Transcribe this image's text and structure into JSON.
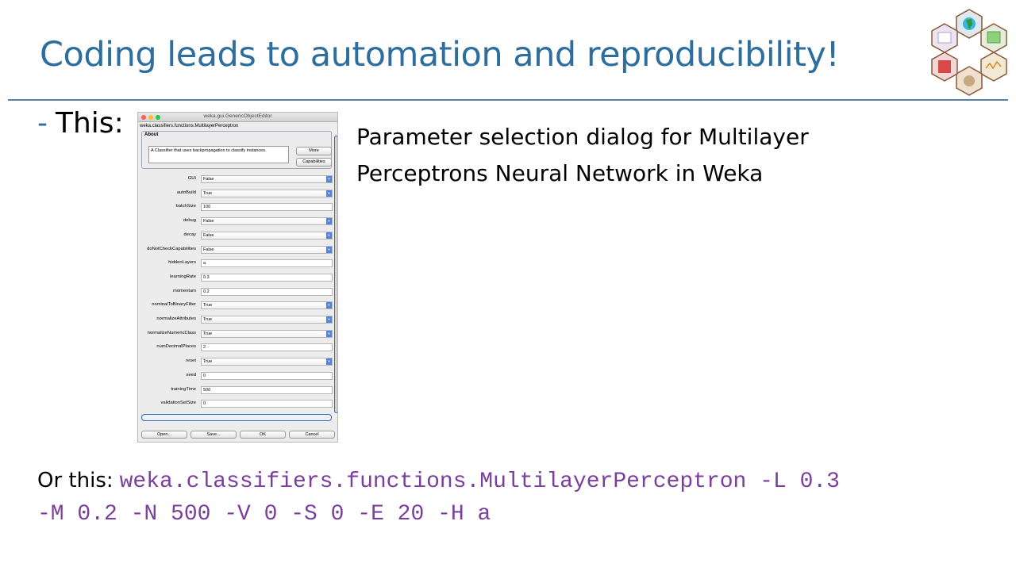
{
  "slide": {
    "title": "Coding leads to automation and reproducibility!",
    "bullet_dash": "-",
    "bullet_label": "This:",
    "description_line1": "Parameter selection dialog for Multilayer",
    "description_line2": "Perceptrons Neural Network in Weka",
    "cmd_prefix": "Or this:",
    "cmd_line1": "weka.classifiers.functions.MultilayerPerceptron -L 0.3",
    "cmd_line2": "-M 0.2 -N 500 -V 0 -S 0 -E 20 -H a"
  },
  "dialog": {
    "window_title": "weka.gui.GenericObjectEditor",
    "class_name": "weka.classifiers.functions.MultilayerPerceptron",
    "about_label": "About",
    "about_text": "A Classifier that uses backpropagation to classify instances.",
    "more_label": "More",
    "capabilities_label": "Capabilities",
    "params": [
      {
        "label": "GUI",
        "value": "False",
        "kind": "combo"
      },
      {
        "label": "autoBuild",
        "value": "True",
        "kind": "combo"
      },
      {
        "label": "batchSize",
        "value": "100",
        "kind": "text"
      },
      {
        "label": "debug",
        "value": "False",
        "kind": "combo"
      },
      {
        "label": "decay",
        "value": "False",
        "kind": "combo"
      },
      {
        "label": "doNotCheckCapabilities",
        "value": "False",
        "kind": "combo"
      },
      {
        "label": "hiddenLayers",
        "value": "a",
        "kind": "text"
      },
      {
        "label": "learningRate",
        "value": "0.3",
        "kind": "text"
      },
      {
        "label": "momentum",
        "value": "0.2",
        "kind": "text"
      },
      {
        "label": "nominalToBinaryFilter",
        "value": "True",
        "kind": "combo"
      },
      {
        "label": "normalizeAttributes",
        "value": "True",
        "kind": "combo"
      },
      {
        "label": "normalizeNumericClass",
        "value": "True",
        "kind": "combo"
      },
      {
        "label": "numDecimalPlaces",
        "value": "2",
        "kind": "text"
      },
      {
        "label": "reset",
        "value": "True",
        "kind": "combo"
      },
      {
        "label": "seed",
        "value": "0",
        "kind": "text"
      },
      {
        "label": "trainingTime",
        "value": "500",
        "kind": "text"
      },
      {
        "label": "validationSetSize",
        "value": "0",
        "kind": "text"
      }
    ],
    "buttons": {
      "open": "Open...",
      "save": "Save...",
      "ok": "OK",
      "cancel": "Cancel"
    }
  },
  "colors": {
    "title": "#2e6e9e",
    "command": "#7a3f9e",
    "rule": "#5b7fa6"
  }
}
